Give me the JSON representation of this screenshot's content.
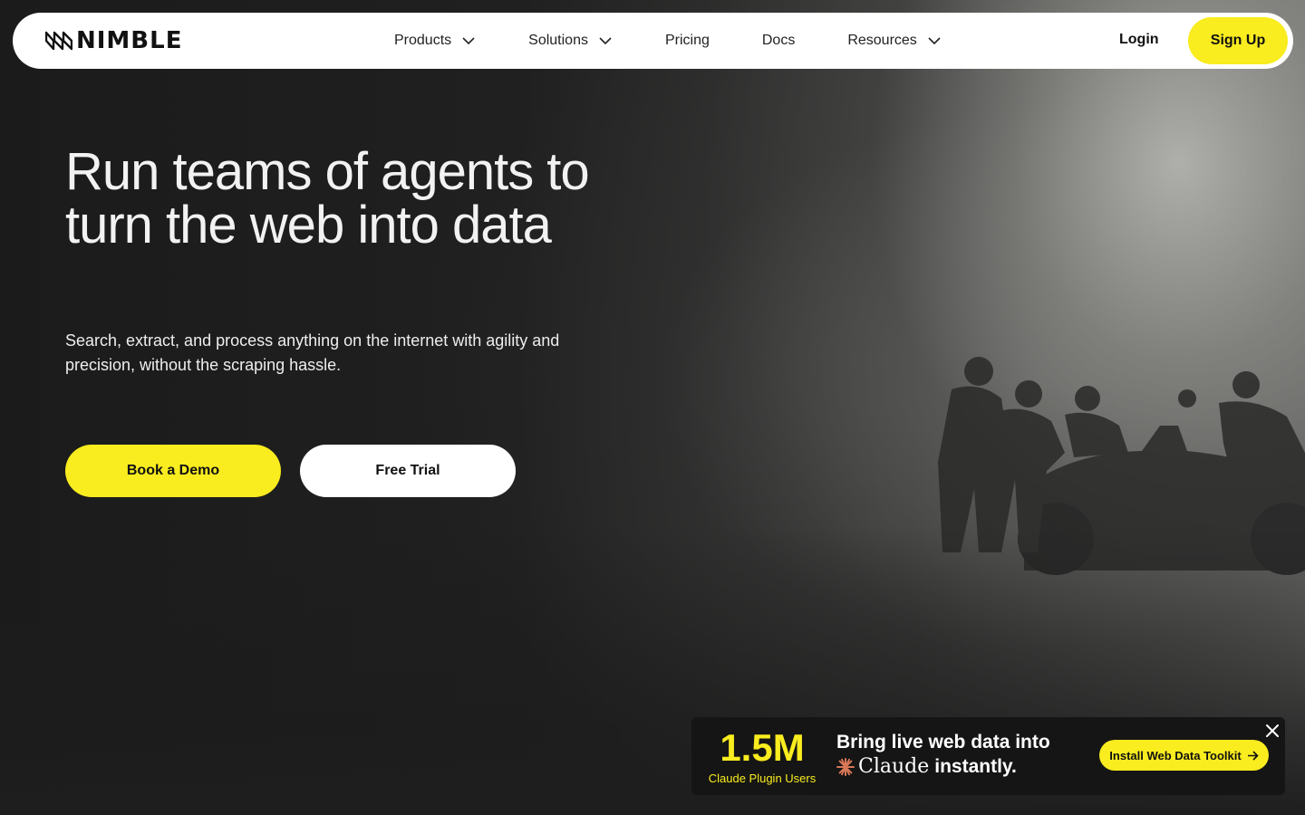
{
  "brand": {
    "name": "NIMBLE",
    "logo_icon": "nimble-logo-mark"
  },
  "nav": {
    "items": [
      {
        "label": "Products",
        "has_dropdown": true
      },
      {
        "label": "Solutions",
        "has_dropdown": true
      },
      {
        "label": "Pricing",
        "has_dropdown": false
      },
      {
        "label": "Docs",
        "has_dropdown": false
      },
      {
        "label": "Resources",
        "has_dropdown": true
      }
    ],
    "login_label": "Login",
    "signup_label": "Sign Up"
  },
  "hero": {
    "headline": "Run teams of agents to turn the web into data",
    "subtext": "Search, extract, and process anything on the internet with agility and precision, without the scraping hassle.",
    "primary_cta": "Book a Demo",
    "secondary_cta": "Free Trial",
    "background_image": "pit-crew-race-car-fog"
  },
  "promo": {
    "stat_value": "1.5M",
    "stat_caption": "Claude Plugin Users",
    "line1": "Bring live web data into",
    "claude_word": "Claude",
    "line2_suffix": "instantly.",
    "cta_label": "Install Web Data Toolkit",
    "close_icon": "close-icon"
  },
  "colors": {
    "accent": "#f9ec1f",
    "background": "#1c1c1c",
    "nav_background": "#ffffff",
    "claude_brand": "#d97757"
  }
}
